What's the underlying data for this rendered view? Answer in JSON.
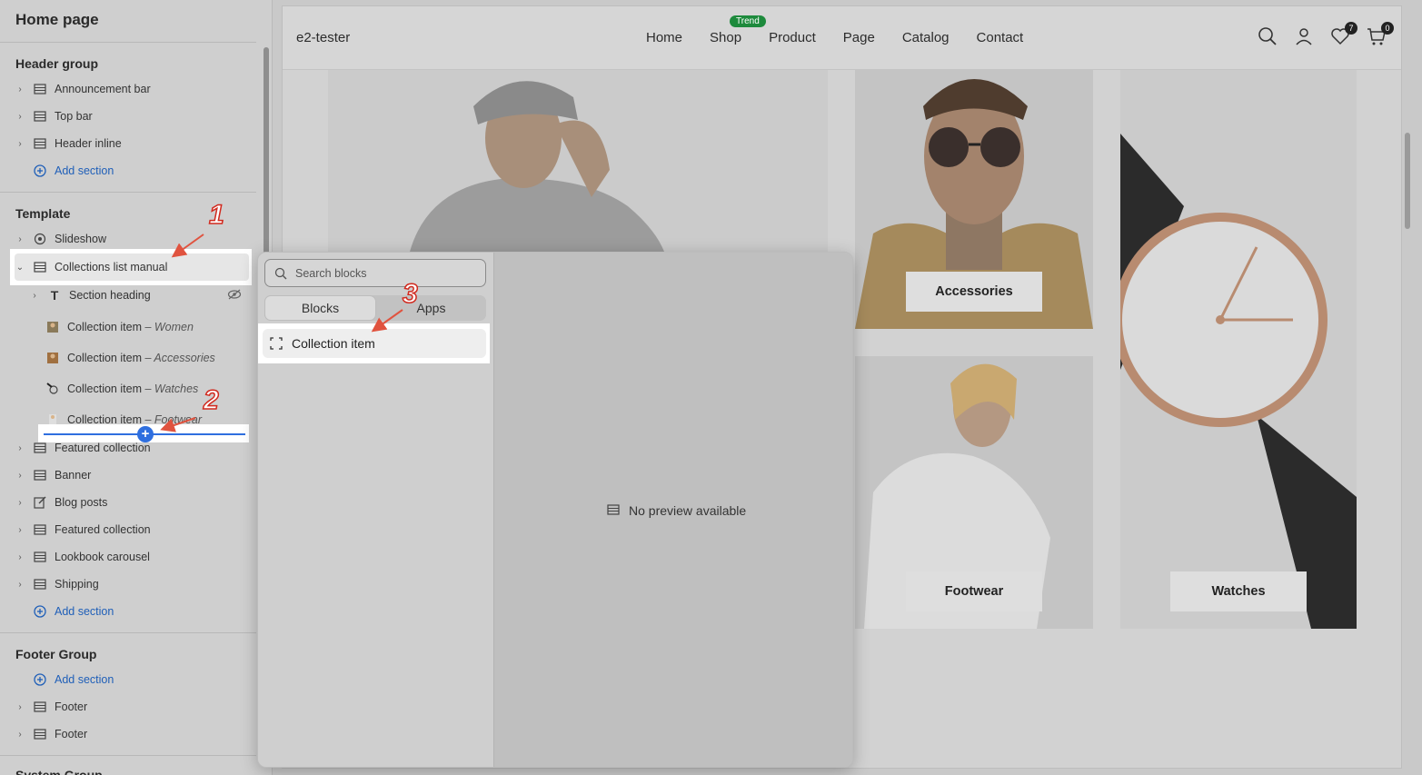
{
  "sidebar": {
    "title": "Home page",
    "header_group": {
      "title": "Header group",
      "items": [
        "Announcement bar",
        "Top bar",
        "Header inline"
      ],
      "add_label": "Add section"
    },
    "template": {
      "title": "Template",
      "slideshow": "Slideshow",
      "selected": "Collections list manual",
      "section_heading": "Section heading",
      "blocks": [
        {
          "prefix": "Collection item",
          "suffix": " – Women"
        },
        {
          "prefix": "Collection item",
          "suffix": " – Accessories"
        },
        {
          "prefix": "Collection item",
          "suffix": " – Watches"
        },
        {
          "prefix": "Collection item",
          "suffix": " – Footwear"
        }
      ],
      "sections": [
        "Featured collection",
        "Banner",
        "Blog posts",
        "Featured collection",
        "Lookbook carousel",
        "Shipping"
      ],
      "add_label": "Add section"
    },
    "footer_group": {
      "title": "Footer Group",
      "add_label": "Add section",
      "items": [
        "Footer",
        "Footer"
      ]
    },
    "system_group": {
      "title": "System Group"
    }
  },
  "picker": {
    "search_placeholder": "Search blocks",
    "tabs": [
      "Blocks",
      "Apps"
    ],
    "item": "Collection item",
    "no_preview": "No preview available"
  },
  "store": {
    "brand": "e2-tester",
    "nav": [
      "Home",
      "Shop",
      "Product",
      "Page",
      "Catalog",
      "Contact"
    ],
    "shop_badge": "Trend",
    "wishlist_count": "7",
    "cart_count": "0",
    "cards": [
      "Accessories",
      "Footwear",
      "Watches"
    ]
  },
  "annotations": [
    "1",
    "2",
    "3"
  ],
  "colors": {
    "accent_blue": "#2f6fdf",
    "badge_green": "#1d8a3c",
    "annotation_red": "#d12a1f"
  }
}
